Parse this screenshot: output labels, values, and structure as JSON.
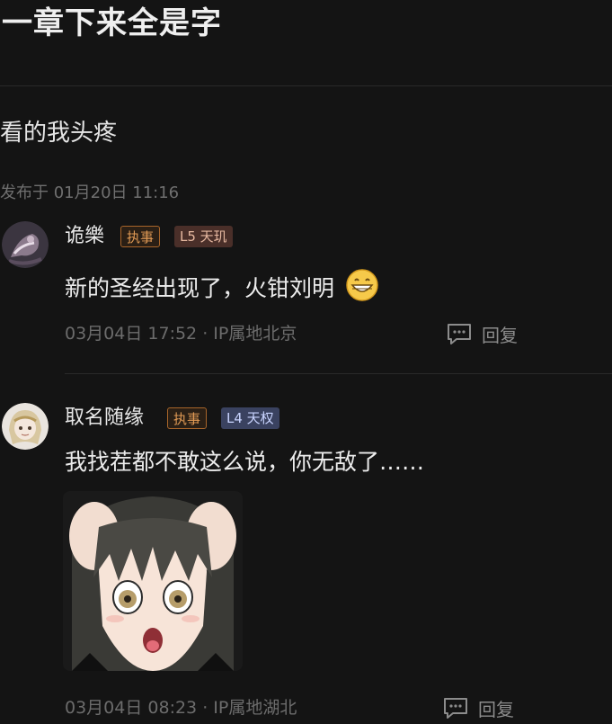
{
  "post": {
    "title": "一章下来全是字",
    "body": "看的我头疼",
    "meta": "发布于 01月20日 11:16"
  },
  "comments": [
    {
      "username": "诡樂",
      "role_badge": "执事",
      "level_badge": "L5 天玑",
      "text": "新的圣经出现了，火钳刘明",
      "emoji": "grinning-face-emoji",
      "meta": "03月04日 17:52 · IP属地北京",
      "reply_label": "回复"
    },
    {
      "username": "取名随缘",
      "role_badge": "执事",
      "level_badge": "L4 天权",
      "text": "我找茬都不敢这么说，你无敌了……",
      "sticker": "anime-girl-shocked-sticker",
      "meta": "03月04日 08:23 · IP属地湖北",
      "reply_label": "回复"
    }
  ],
  "colors": {
    "background": "#141414",
    "role_badge": "#e09a55",
    "level5_badge_bg": "#4a2f29",
    "level4_badge_bg": "#3a4260"
  }
}
